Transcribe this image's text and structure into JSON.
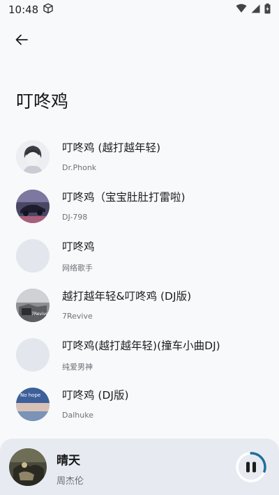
{
  "status_bar": {
    "time": "10:48"
  },
  "header": {
    "title": "叮咚鸡"
  },
  "songs": [
    {
      "title": "叮咚鸡 (越打越年轻)",
      "artist": "Dr.Phonk"
    },
    {
      "title": "叮咚鸡（宝宝肚肚打雷啦)",
      "artist": "DJ-798"
    },
    {
      "title": "叮咚鸡",
      "artist": "网络歌手"
    },
    {
      "title": "越打越年轻&叮咚鸡 (DJ版)",
      "artist": "7Revive"
    },
    {
      "title": "叮咚鸡(越打越年轻)(撞车小曲DJ)",
      "artist": "纯爱男神"
    },
    {
      "title": "叮咚鸡 (DJ版)",
      "artist": "Dalhuke"
    }
  ],
  "cover_texts": {
    "revive": "7Revive",
    "nohope": "No hope"
  },
  "now_playing": {
    "title": "晴天",
    "artist": "周杰伦",
    "progress": 0.3
  },
  "colors": {
    "accent": "#1f6f9e",
    "background": "#f8f9fb",
    "player_bg": "#e7ebf1"
  }
}
